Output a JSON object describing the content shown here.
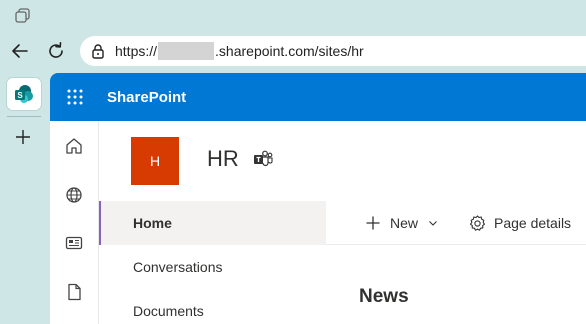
{
  "browser": {
    "url_prefix": "https://",
    "url_suffix": ".sharepoint.com/sites/hr"
  },
  "sharepoint": {
    "brand": "SharePoint",
    "site_logo_letter": "H",
    "site_title": "HR",
    "site_logo_color": "#d83b01",
    "suite_color": "#0078d4"
  },
  "site_nav": {
    "items": [
      {
        "label": "Home"
      },
      {
        "label": "Conversations"
      },
      {
        "label": "Documents"
      }
    ]
  },
  "command_bar": {
    "new_label": "New",
    "page_details_label": "Page details"
  },
  "news": {
    "title": "News"
  },
  "icons": {
    "titlebar": "tab-actions-icon",
    "back": "back-arrow-icon",
    "reload": "reload-icon",
    "lock": "lock-icon",
    "sp_tab": "sharepoint-tab-icon",
    "new_tab": "plus-icon",
    "waffle": "app-launcher-icon",
    "rail": [
      "home-icon",
      "globe-icon",
      "news-icon",
      "document-icon"
    ],
    "teams": "teams-icon",
    "new": "plus-icon",
    "new_chevron": "chevron-down-icon",
    "details": "gear-icon"
  }
}
